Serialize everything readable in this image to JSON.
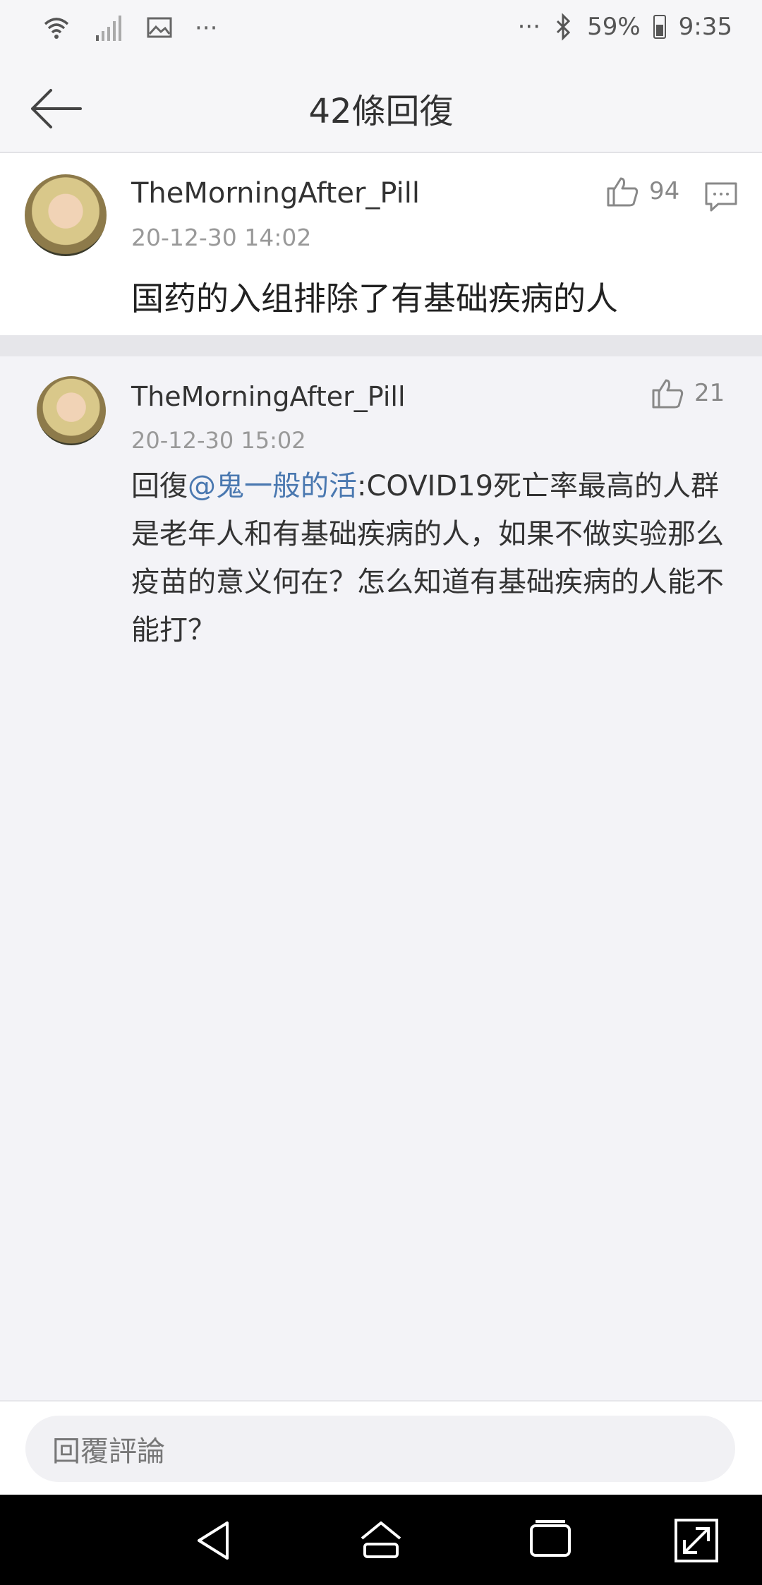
{
  "status_bar": {
    "dots_left": "···",
    "dots_right": "···",
    "battery_percent": "59%",
    "time": "9:35"
  },
  "header": {
    "title": "42條回復"
  },
  "main_comment": {
    "username": "TheMorningAfter_Pill",
    "timestamp": "20-12-30 14:02",
    "likes": "94",
    "text": "国药的入组排除了有基础疾病的人"
  },
  "reply": {
    "username": "TheMorningAfter_Pill",
    "timestamp": "20-12-30 15:02",
    "likes": "21",
    "prefix": "回復",
    "mention": "@鬼一般的活",
    "text": ":COVID19死亡率最高的人群是老年人和有基础疾病的人，如果不做实验那么疫苗的意义何在？怎么知道有基础疾病的人能不能打？"
  },
  "input": {
    "placeholder": "回覆評論"
  },
  "icons": {
    "wifi": "wifi-icon",
    "signal": "signal-icon",
    "image": "image-icon",
    "bluetooth": "bluetooth-icon",
    "battery": "battery-icon",
    "back": "back-arrow-icon",
    "like": "thumbs-up-icon",
    "comment": "comment-icon",
    "nav_back": "nav-back-icon",
    "nav_home": "nav-home-icon",
    "nav_recent": "nav-recent-icon",
    "nav_expand": "nav-expand-icon"
  },
  "colors": {
    "mention": "#4a78b0",
    "background": "#f3f3f7"
  }
}
